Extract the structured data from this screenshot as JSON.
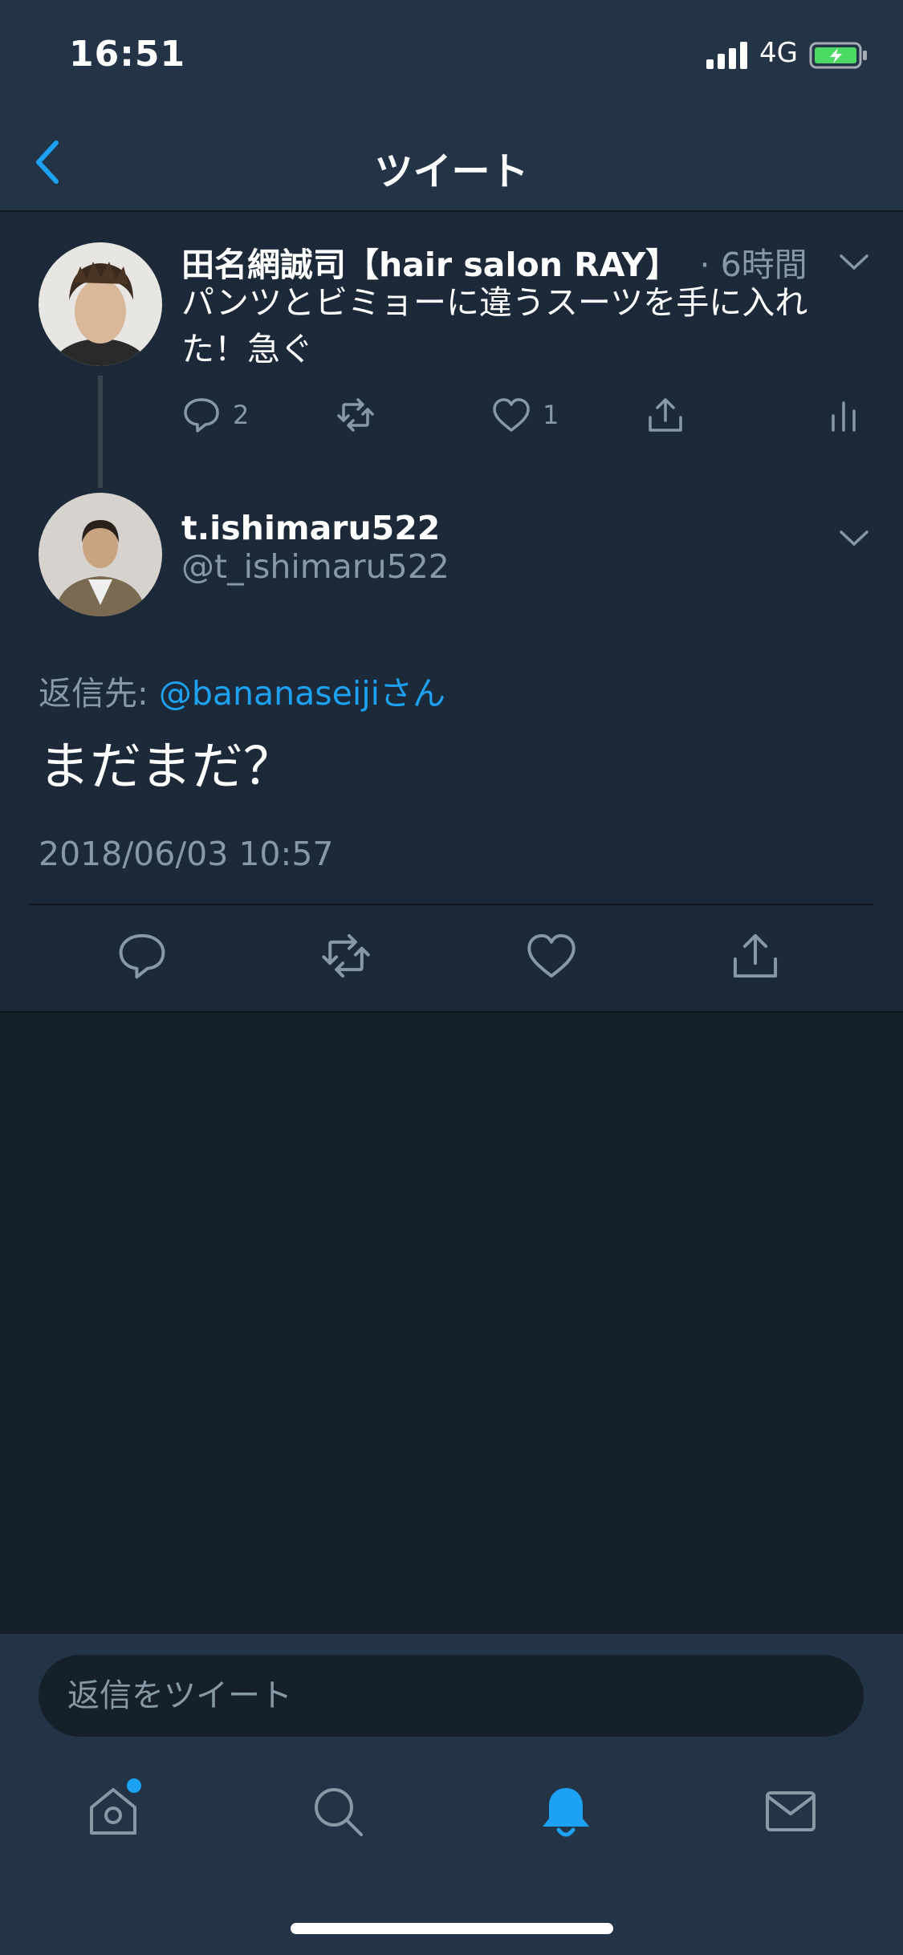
{
  "status_bar": {
    "time": "16:51",
    "network": "4G"
  },
  "nav": {
    "title": "ツイート"
  },
  "parent_tweet": {
    "display_name": "田名網誠司【hair salon RAY】",
    "time_ago": "· 6時間",
    "text": "パンツとビミョーに違うスーツを手に入れた！急ぐ",
    "reply_count": "2",
    "like_count": "1"
  },
  "main_tweet": {
    "display_name": "t.ishimaru522",
    "handle": "@t_ishimaru522",
    "reply_to_label": "返信先: ",
    "reply_to_user": "@bananaseijiさん",
    "text": "まだまだ？",
    "timestamp": "2018/06/03 10:57"
  },
  "reply_bar": {
    "placeholder": "返信をツイート"
  },
  "colors": {
    "accent": "#1da1f2",
    "background": "#15202b",
    "card": "#1c2938",
    "bar": "#243447",
    "muted": "#8899a6"
  },
  "icons": [
    "chevron-left-icon",
    "reply-icon",
    "retweet-icon",
    "like-icon",
    "share-icon",
    "analytics-icon",
    "home-icon",
    "search-icon",
    "notifications-icon",
    "messages-icon"
  ]
}
